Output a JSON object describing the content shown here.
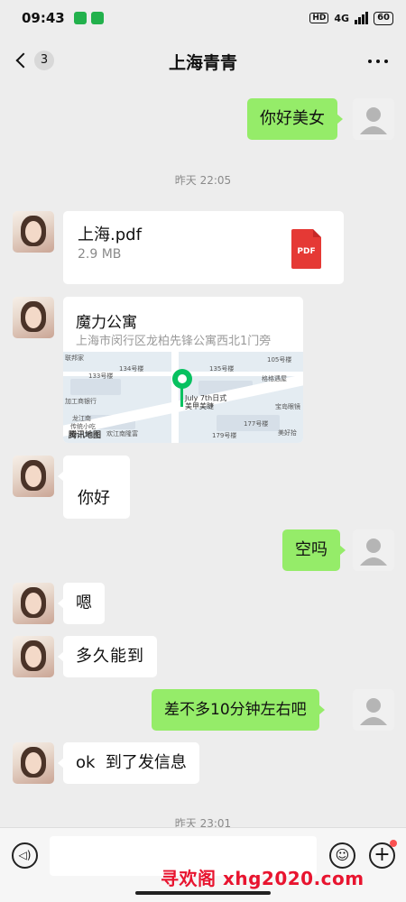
{
  "status_bar": {
    "time": "09:43",
    "hd": "HD",
    "network": "4G",
    "battery": "60"
  },
  "nav": {
    "unread_count": "3",
    "title": "上海青青"
  },
  "timestamps": [
    "昨天 22:05",
    "昨天 23:01"
  ],
  "messages": {
    "m1": "你好美女",
    "file": {
      "name": "上海.pdf",
      "size": "2.9 MB",
      "type_badge": "PDF"
    },
    "location": {
      "name": "魔力公寓",
      "address": "上海市闵行区龙柏先锋公寓西北1门旁",
      "map_poi": "July 7th日式\n美甲美睫",
      "map_brand": "腾讯地图",
      "map_labels": [
        "联邦家",
        "134号楼",
        "135号楼",
        "105号楼",
        "133号楼",
        "格格遇屋",
        "加工商银行",
        "宝岛眼镜",
        "龙江南",
        "传统小吃",
        "欢江南隆富",
        "177号楼",
        "179号楼",
        "美好拾"
      ]
    },
    "m4": "你好",
    "m5": "空吗",
    "m6": "嗯",
    "m7": "多久能到",
    "m8": "差不多10分钟左右吧",
    "m9": "ok  到了发信息"
  },
  "input_bar": {
    "placeholder": "",
    "voice_glyph": "◁)",
    "emoji_glyph": "☺",
    "plus_glyph": "+"
  },
  "watermark": "寻欢阁 xhg2020.com",
  "colors": {
    "self_bubble": "#95ec69",
    "peer_bubble": "#ffffff",
    "pin": "#07c160",
    "watermark": "#e8142f"
  }
}
